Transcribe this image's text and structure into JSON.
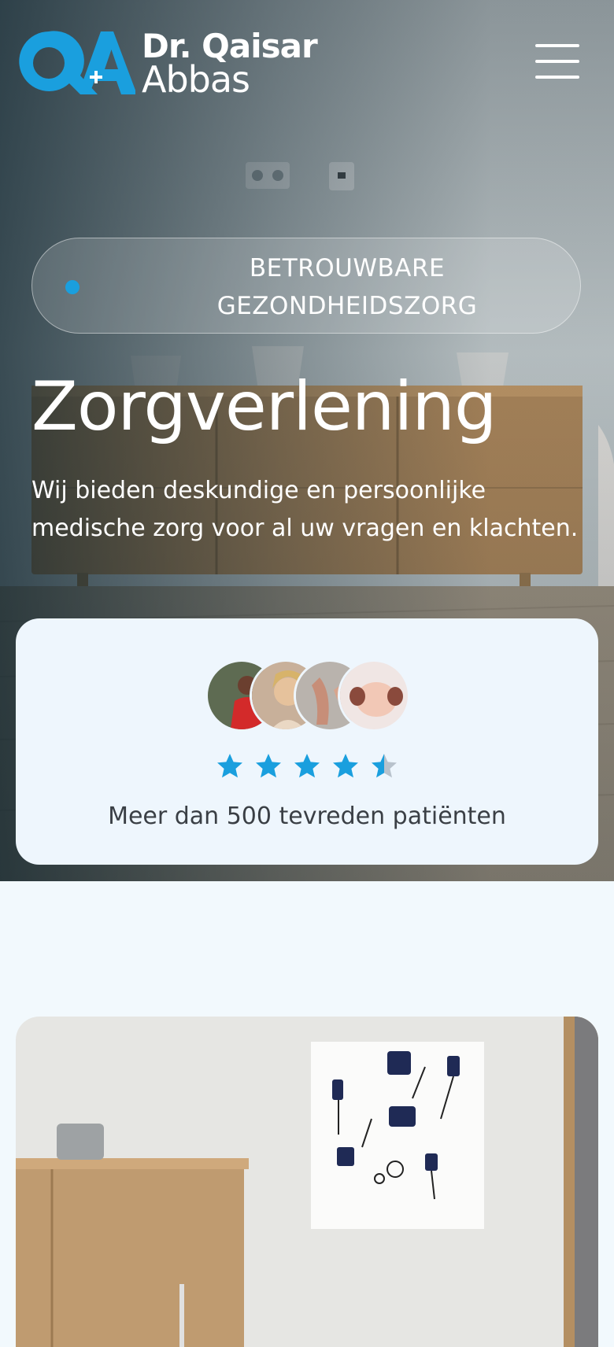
{
  "brand": {
    "line1": "Dr. Qaisar",
    "line2": "Abbas",
    "accent": "#1a9fde"
  },
  "header": {
    "menu_icon": "hamburger-menu-icon"
  },
  "hero": {
    "badge": "BETROUWBARE GEZONDHEIDSZORG",
    "title": "Zorgverlening",
    "subtitle": "Wij bieden deskundige en persoonlijke medische zorg voor al uw vragen en klachten."
  },
  "rating": {
    "rating_value": 4.5,
    "max_stars": 5,
    "label": "Meer dan 500 tevreden patiënten",
    "star_color": "#1a9fde"
  }
}
